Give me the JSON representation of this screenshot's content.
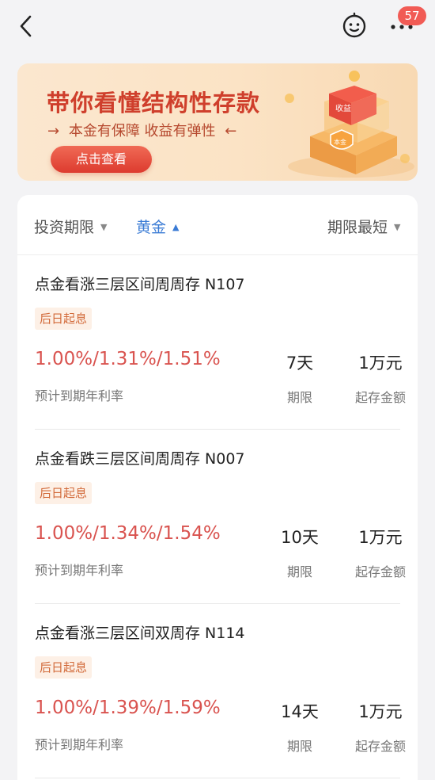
{
  "topbar": {
    "badge_count": "57"
  },
  "banner": {
    "title": "带你看懂结构性存款",
    "subtitle": "本金有保障 收益有弹性",
    "subtitle_arrow_left": "→",
    "subtitle_arrow_right": "←",
    "button_label": "点击查看",
    "art_label_top": "收益",
    "art_label_shield": "本金"
  },
  "filters": [
    {
      "label": "投资期限",
      "caret": "▼",
      "active": false
    },
    {
      "label": "黄金",
      "caret": "▲",
      "active": true
    },
    {
      "label": "期限最短",
      "caret": "▼",
      "active": false
    }
  ],
  "products": [
    {
      "name": "点金看涨三层区间周周存 N107",
      "tag": "后日起息",
      "rate": "1.00%/1.31%/1.51%",
      "rate_label": "预计到期年利率",
      "term": "7天",
      "term_label": "期限",
      "min_amount": "1万元",
      "min_amount_label": "起存金额"
    },
    {
      "name": "点金看跌三层区间周周存 N007",
      "tag": "后日起息",
      "rate": "1.00%/1.34%/1.54%",
      "rate_label": "预计到期年利率",
      "term": "10天",
      "term_label": "期限",
      "min_amount": "1万元",
      "min_amount_label": "起存金额"
    },
    {
      "name": "点金看涨三层区间双周存 N114",
      "tag": "后日起息",
      "rate": "1.00%/1.39%/1.59%",
      "rate_label": "预计到期年利率",
      "term": "14天",
      "term_label": "期限",
      "min_amount": "1万元",
      "min_amount_label": "起存金额"
    }
  ],
  "colors": {
    "accent_red": "#d9534f",
    "active_blue": "#3a7bd5",
    "banner_title": "#cf3f2c",
    "tag_text": "#d26a3a",
    "tag_bg": "#fdf0e6",
    "badge": "#f15b55"
  }
}
